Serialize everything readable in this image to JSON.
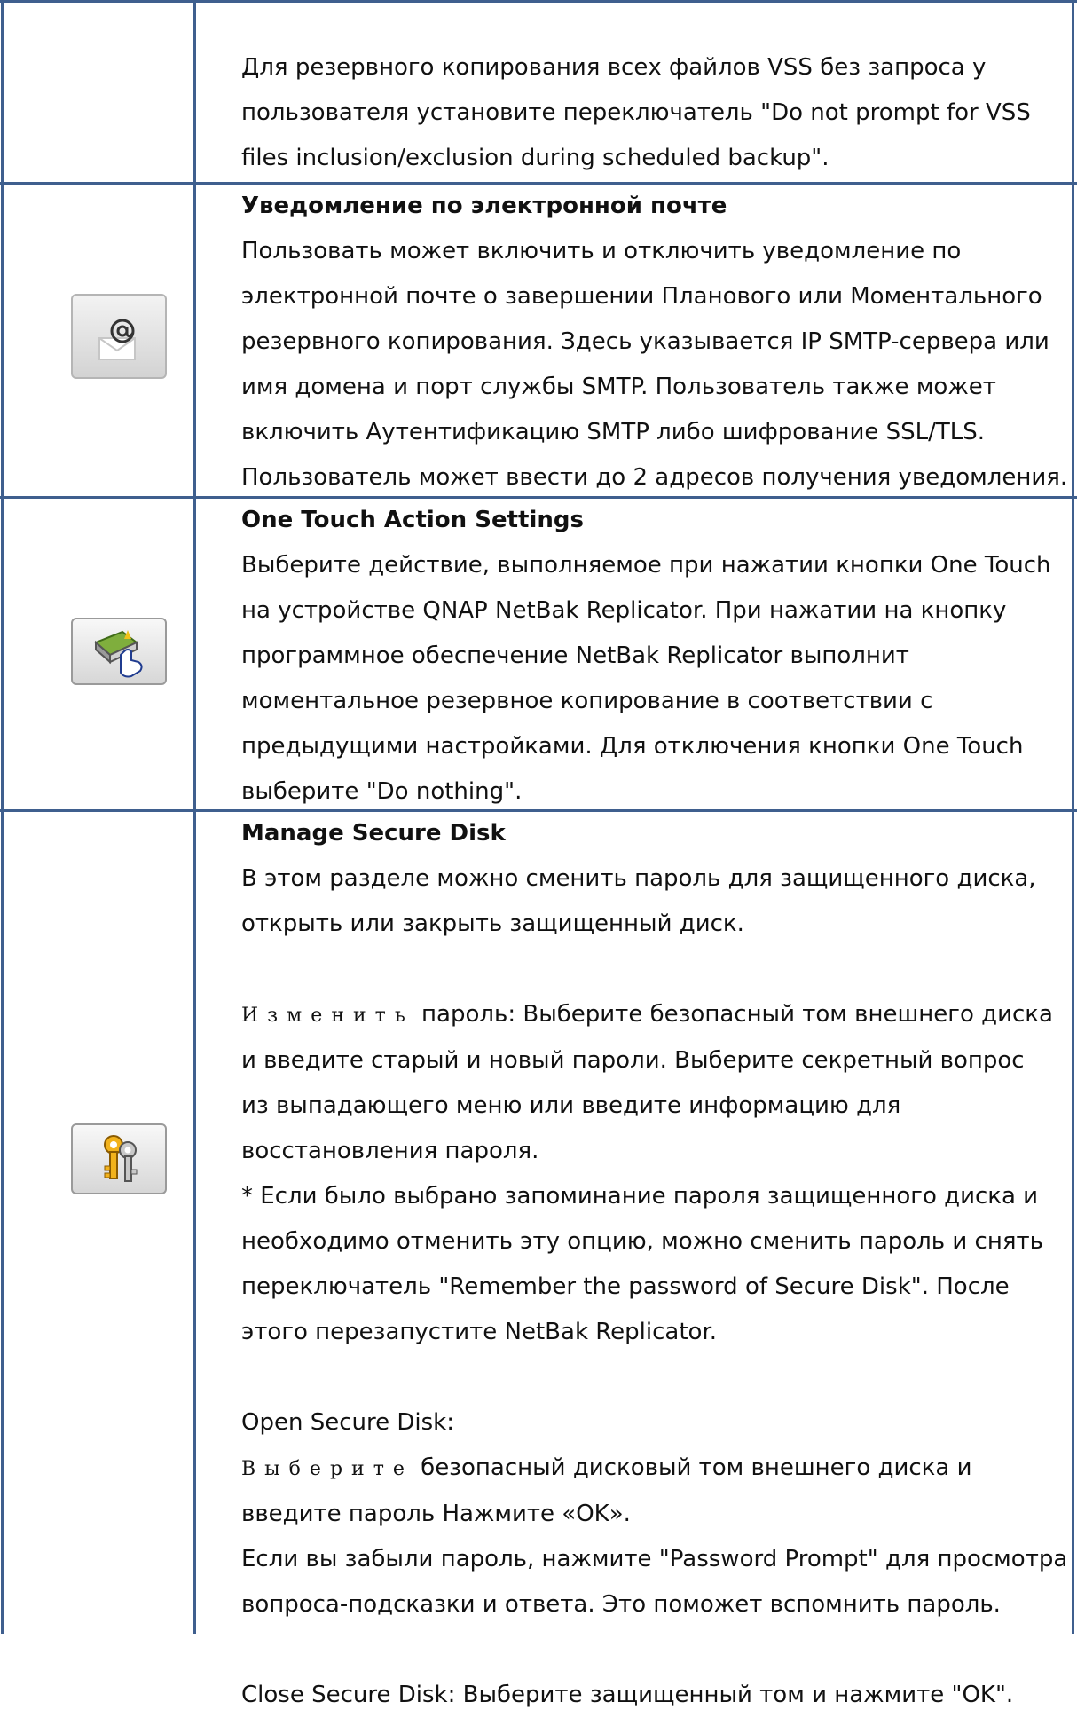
{
  "rows": {
    "vss": {
      "lines": [
        "Для резервного копирования всех файлов VSS без запроса у",
        "пользователя установите переключатель \"Do not prompt for VSS",
        "files inclusion/exclusion during scheduled backup\"."
      ]
    },
    "email": {
      "icon": "email-at-icon",
      "title": "Уведомление по электронной почте",
      "lines": [
        "Пользовать может включить и отключить уведомление по",
        "электронной почте о завершении Планового или Моментального",
        "резервного копирования.   Здесь указывается IP SMTP-сервера или",
        "имя домена и порт службы SMTP. Пользователь также может",
        "включить Аутентификацию SMTP либо шифрование SSL/TLS.",
        "Пользователь может ввести до 2 адресов получения уведомления."
      ]
    },
    "onetouch": {
      "icon": "one-touch-icon",
      "title": "One Touch Action Settings",
      "lines": [
        "Выберите действие, выполняемое при нажатии кнопки One Touch",
        "на устройстве QNAP NetBak Replicator. При нажатии на кнопку",
        "программное обеспечение NetBak Replicator выполнит",
        "моментальное резервное копирование в соответствии с",
        "предыдущими настройками. Для отключения кнопки One Touch",
        "выберите \"Do nothing\"."
      ]
    },
    "securedisk": {
      "icon": "keys-icon",
      "title": "Manage Secure Disk",
      "intro": [
        "В этом разделе можно сменить пароль для защищенного диска,",
        "открыть или закрыть защищенный диск."
      ],
      "change_word": "Изменить",
      "change_line1_rest": " пароль: Выберите безопасный том внешнего диска",
      "change_lines": [
        "и введите   старый и новый пароли.   Выберите секретный вопрос",
        "из выпадающего меню или введите информацию для",
        "восстановления пароля."
      ],
      "note_lines": [
        "* Если было выбрано запоминание пароля защищенного диска и",
        "необходимо отменить эту опцию, можно сменить пароль и снять",
        "переключатель \"Remember the password of Secure Disk\". После",
        "этого перезапустите NetBak Replicator."
      ],
      "open_heading": "Open Secure Disk:",
      "open_word": "Выберите",
      "open_line1_rest": " безопасный дисковый том внешнего диска и",
      "open_lines": [
        "введите пароль   Нажмите «OK».",
        "Если вы забыли пароль, нажмите \"Password Prompt\" для просмотра",
        "вопроса-подсказки и ответа. Это поможет вспомнить пароль."
      ],
      "close_line": "Close Secure Disk: Выберите защищенный том и нажмите \"OK\"."
    }
  }
}
